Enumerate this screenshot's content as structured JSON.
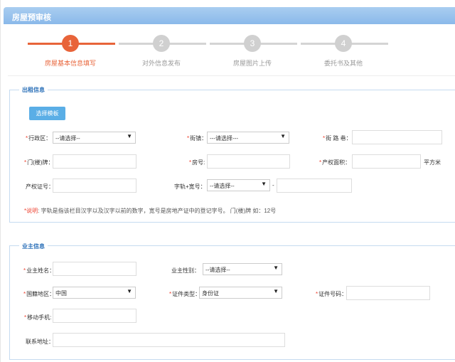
{
  "header": {
    "title": "房屋预审核"
  },
  "steps": [
    {
      "num": "1",
      "label": "房屋基本信息填写"
    },
    {
      "num": "2",
      "label": "对外信息发布"
    },
    {
      "num": "3",
      "label": "房屋图片上传"
    },
    {
      "num": "4",
      "label": "委托书及其他"
    }
  ],
  "rent": {
    "legend": "出租信息",
    "template_btn": "选择模板",
    "district": {
      "label": "行政区：",
      "value": "--请选择--"
    },
    "street": {
      "label": "街镇：",
      "value": "---请选择---"
    },
    "road": {
      "label": "街 路 巷："
    },
    "door": {
      "label": "门(楼)牌："
    },
    "room": {
      "label": "房号:"
    },
    "area": {
      "label": "产权面积：",
      "unit": "平方米"
    },
    "cert": {
      "label": "产权证号："
    },
    "zigui": {
      "label": "字轨+宽号：",
      "value": "--请选择--",
      "dash": "-"
    },
    "note": {
      "prefix": "*说明",
      "text": ": 字轨是指该栏目汉字以及汉字以前的数字，宽号是房地产证中的登记字号。 门(楼)牌 如：12号"
    }
  },
  "owner": {
    "legend": "业主信息",
    "name": {
      "label": "业主姓名："
    },
    "gender": {
      "label": "业主性别：",
      "value": "--请选择--"
    },
    "country": {
      "label": "国籍地区：",
      "value": "中国"
    },
    "idtype": {
      "label": "证件类型：",
      "value": "身份证"
    },
    "idnum": {
      "label": "证件号码："
    },
    "mobile": {
      "label": "移动手机:"
    },
    "address": {
      "label": "联系地址："
    }
  },
  "colors": {
    "accent": "#e8643a",
    "header": "#8ab9ea",
    "legend": "#2a6fb8",
    "required": "#e43333"
  }
}
